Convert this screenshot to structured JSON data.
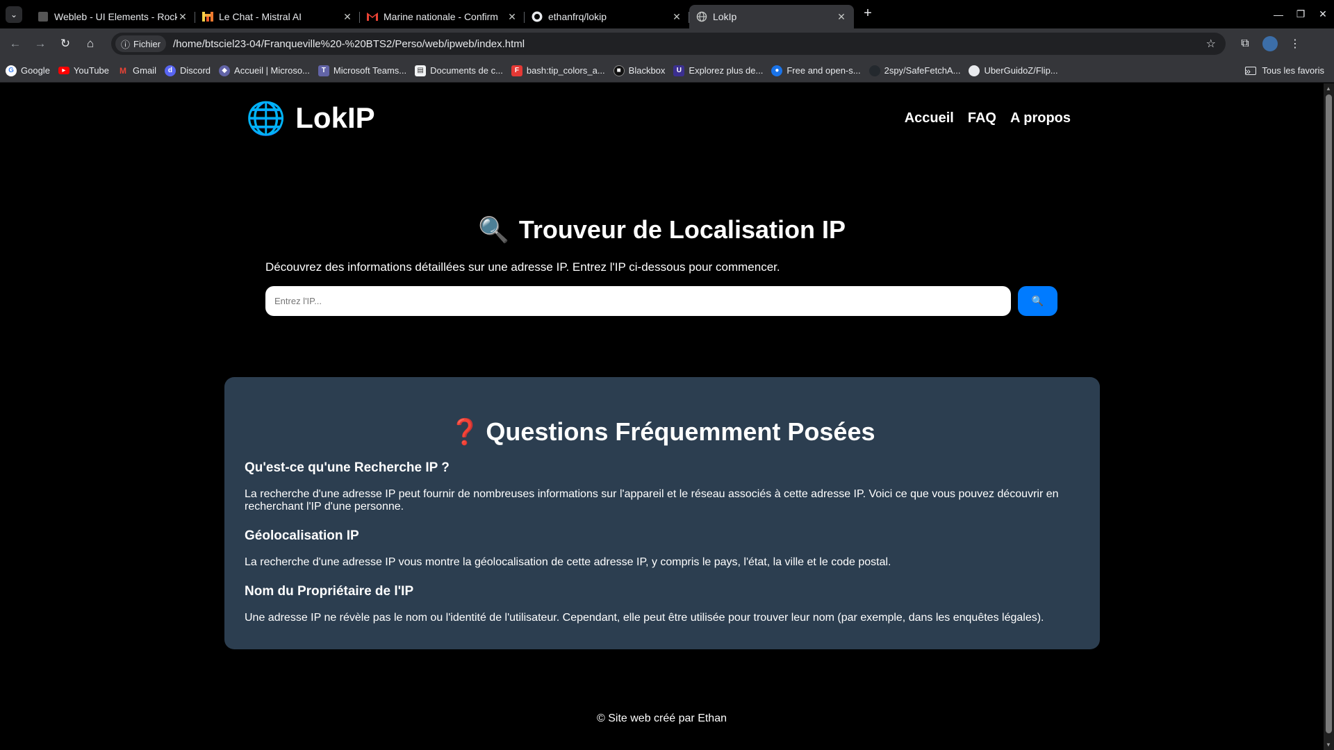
{
  "browser": {
    "tabs": [
      {
        "title": "Webleb - UI Elements - Rock",
        "icon": "webleb-icon",
        "active": false
      },
      {
        "title": "Le Chat - Mistral AI",
        "icon": "mistral-icon",
        "active": false
      },
      {
        "title": "Marine nationale - Confirm",
        "icon": "gmail-icon",
        "active": false
      },
      {
        "title": "ethanfrq/lokip",
        "icon": "github-icon",
        "active": false
      },
      {
        "title": "LokIp",
        "icon": "globe-icon",
        "active": true
      }
    ],
    "site_chip": "Fichier",
    "url": "/home/btsciel23-04/Franqueville%20-%20BTS2/Perso/web/ipweb/index.html",
    "bookmarks": [
      {
        "label": "Google",
        "color": "#ffffff"
      },
      {
        "label": "YouTube",
        "color": "#ff0000"
      },
      {
        "label": "Gmail",
        "color": "#ea4335"
      },
      {
        "label": "Discord",
        "color": "#5865f2"
      },
      {
        "label": "Accueil | Microso...",
        "color": "#6264a7"
      },
      {
        "label": "Microsoft Teams...",
        "color": "#6264a7"
      },
      {
        "label": "Documents de c...",
        "color": "#f1f3f4"
      },
      {
        "label": "bash:tip_colors_a...",
        "color": "#e53935"
      },
      {
        "label": "Blackbox",
        "color": "#111111"
      },
      {
        "label": "Explorez plus de...",
        "color": "#3b2f8f"
      },
      {
        "label": "Free and open-s...",
        "color": "#1a73e8"
      },
      {
        "label": "2spy/SafeFetchA...",
        "color": "#24292e"
      },
      {
        "label": "UberGuidoZ/Flip...",
        "color": "#24292e"
      }
    ],
    "all_bookmarks": "Tous les favoris"
  },
  "site": {
    "brand": "LokIP",
    "nav": [
      "Accueil",
      "FAQ",
      "A propos"
    ],
    "hero_title": "Trouveur de Localisation IP",
    "hero_desc": "Découvrez des informations détaillées sur une adresse IP. Entrez l'IP ci-dessous pour commencer.",
    "search_placeholder": "Entrez l'IP...",
    "search_button": "🔍",
    "faq_title": "Questions Fréquemment Posées",
    "faq": [
      {
        "q": "Qu'est-ce qu'une Recherche IP ?",
        "a": "La recherche d'une adresse IP peut fournir de nombreuses informations sur l'appareil et le réseau associés à cette adresse IP. Voici ce que vous pouvez découvrir en recherchant l'IP d'une personne."
      },
      {
        "q": "Géolocalisation IP",
        "a": "La recherche d'une adresse IP vous montre la géolocalisation de cette adresse IP, y compris le pays, l'état, la ville et le code postal."
      },
      {
        "q": "Nom du Propriétaire de l'IP",
        "a": "Une adresse IP ne révèle pas le nom ou l'identité de l'utilisateur. Cependant, elle peut être utilisée pour trouver leur nom (par exemple, dans les enquêtes légales)."
      }
    ],
    "footer": "© Site web créé par Ethan",
    "colors": {
      "background": "#000000",
      "faq_card": "#2c3e50",
      "button": "#007bff"
    }
  }
}
